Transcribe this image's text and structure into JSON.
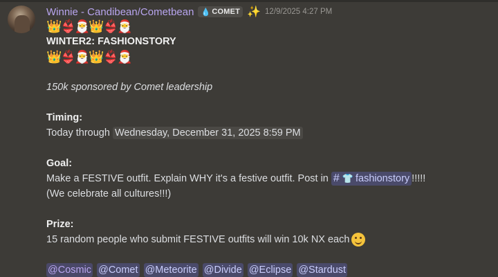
{
  "message": {
    "author": "Winnie - Candibean/Cometbean",
    "role_tag": "COMET",
    "timestamp": "12/9/2025 4:27 PM",
    "emoji_line": "👑👙🎅👑👙🎅",
    "title": "WINTER2: FASHIONSTORY",
    "sponsor": "150k sponsored by Comet leadership",
    "timing_heading": "Timing:",
    "timing_prefix": "Today through ",
    "timing_date": "Wednesday, December 31, 2025 8:59 PM",
    "goal_heading": "Goal:",
    "goal_text": "Make a FESTIVE outfit. Explain WHY it's a festive outfit. Post in ",
    "channel_name": "fashionstory",
    "goal_suffix": "!!!!!",
    "goal_note": "(We celebrate all cultures!!!)",
    "prize_heading": "Prize:",
    "prize_text": "15 random people who submit FESTIVE outfits will win 10k NX each",
    "mentions": [
      "@Cosmic",
      "@Comet",
      "@Meteorite",
      "@Divide",
      "@Eclipse",
      "@Stardust"
    ]
  },
  "icons": {
    "avatar": "user-avatar",
    "role_icon": "droplet-icon",
    "badge": "sparkle-badge-icon",
    "channel_icon": "shirt-icon",
    "smile": "slight-smile-emoji-icon"
  },
  "colors": {
    "background": "#3d3b37",
    "username": "#b8a5ef",
    "mention_bg": "#4a4a6a",
    "mention_text": "#c9cdfb"
  }
}
